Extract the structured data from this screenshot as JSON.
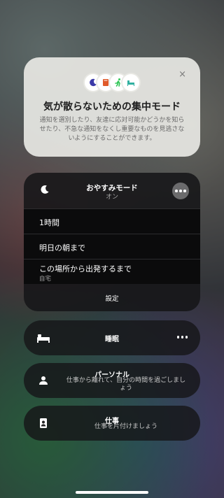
{
  "info_card": {
    "title": "気が散らないための集中モード",
    "description": "通知を選別したり、友達に応対可能かどうかを知らせたり、不急な通知をなくし重要なものを見逃さないようにすることができます。",
    "close_symbol": "×",
    "icons": [
      "moon-icon",
      "book-icon",
      "running-icon",
      "bed-icon"
    ]
  },
  "focus_card": {
    "mode_name": "おやすみモード",
    "status": "オン",
    "options": [
      {
        "label": "1時間"
      },
      {
        "label": "明日の朝まで"
      },
      {
        "label": "この場所から出発するまで",
        "sub": "自宅"
      }
    ],
    "settings_label": "設定"
  },
  "modes": [
    {
      "name": "睡眠",
      "icon": "bed-icon"
    },
    {
      "name": "パーソナル",
      "sub": "仕事から離れて、自分の時間を過ごしましょう",
      "icon": "person-icon"
    },
    {
      "name": "仕事",
      "sub": "仕事を片付けましょう",
      "icon": "badge-icon"
    }
  ],
  "colors": {
    "moon": "#5856d6",
    "book": "#e05a2a",
    "running": "#34c759",
    "bed": "#30b0a0"
  }
}
